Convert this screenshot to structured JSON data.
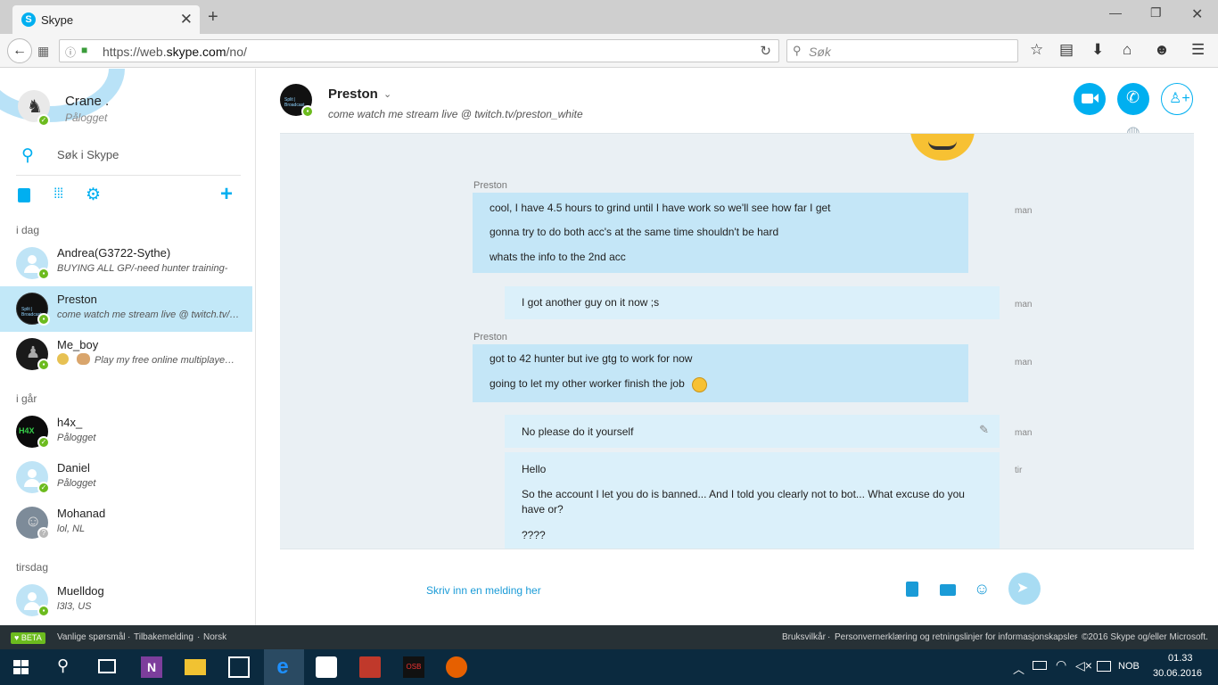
{
  "browser": {
    "tab_title": "Skype",
    "url_prefix": "https://web.",
    "url_domain": "skype.com",
    "url_path": "/no/",
    "search_placeholder": "Søk"
  },
  "profile": {
    "name": "Crane .",
    "status": "Pålogget",
    "search_label": "Søk i Skype"
  },
  "sections": {
    "today": "i dag",
    "yesterday": "i går",
    "tuesday": "tirsdag"
  },
  "contacts": [
    {
      "name": "Andrea(G3722-Sythe)",
      "mood": "BUYING ALL GP/-need hunter training-"
    },
    {
      "name": "Preston",
      "mood": "come watch me stream live @ twitch.tv/preston_white"
    },
    {
      "name": "Me_boy",
      "mood": "Play my free online multiplayer game"
    },
    {
      "name": "h4x_",
      "mood": "Pålogget"
    },
    {
      "name": "Daniel",
      "mood": "Pålogget"
    },
    {
      "name": "Mohanad",
      "mood": "lol, NL"
    },
    {
      "name": "Muelldog",
      "mood": "l3l3, US"
    }
  ],
  "chat": {
    "name": "Preston",
    "mood": "come watch me stream live @ twitch.tv/preston_white",
    "input_placeholder": "Skriv inn en melding her",
    "messages": [
      {
        "sender": "Preston",
        "lines": [
          "cool, I have 4.5 hours to grind until I have work so we'll see how far I get",
          "gonna try to do both acc's at the same time shouldn't be hard",
          "whats the info to the 2nd acc"
        ],
        "time": "man"
      },
      {
        "sender": "",
        "lines": [
          "I got another guy on it now ;s"
        ],
        "time": "man"
      },
      {
        "sender": "Preston",
        "lines": [
          "got to 42 hunter but ive gtg to work for now",
          "going to let my other worker finish the job"
        ],
        "time": "man"
      },
      {
        "sender": "",
        "lines": [
          "No please do it yourself"
        ],
        "time": "man"
      },
      {
        "sender": "",
        "lines": [
          "Hello",
          "So the account I let you do is banned... And I told you clearly not to bot... What excuse do you have or?",
          "????"
        ],
        "time": "tir"
      }
    ]
  },
  "footer": {
    "beta": "BETA",
    "faq": "Vanlige spørsmål",
    "feedback": "Tilbakemelding",
    "lang": "Norsk",
    "terms": "Bruksvilkår",
    "privacy": "Personvernerklæring og retningslinjer for informasjonskapsler",
    "copyright": "©2016 Skype og/eller Microsoft."
  },
  "taskbar": {
    "lang": "NOB",
    "time": "01.33",
    "date": "30.06.2016"
  },
  "colors": {
    "skype_blue": "#00aff0",
    "online_green": "#6cbb1e",
    "incoming_bubble": "#c4e6f7",
    "outgoing_bubble": "#dbf0fa"
  }
}
